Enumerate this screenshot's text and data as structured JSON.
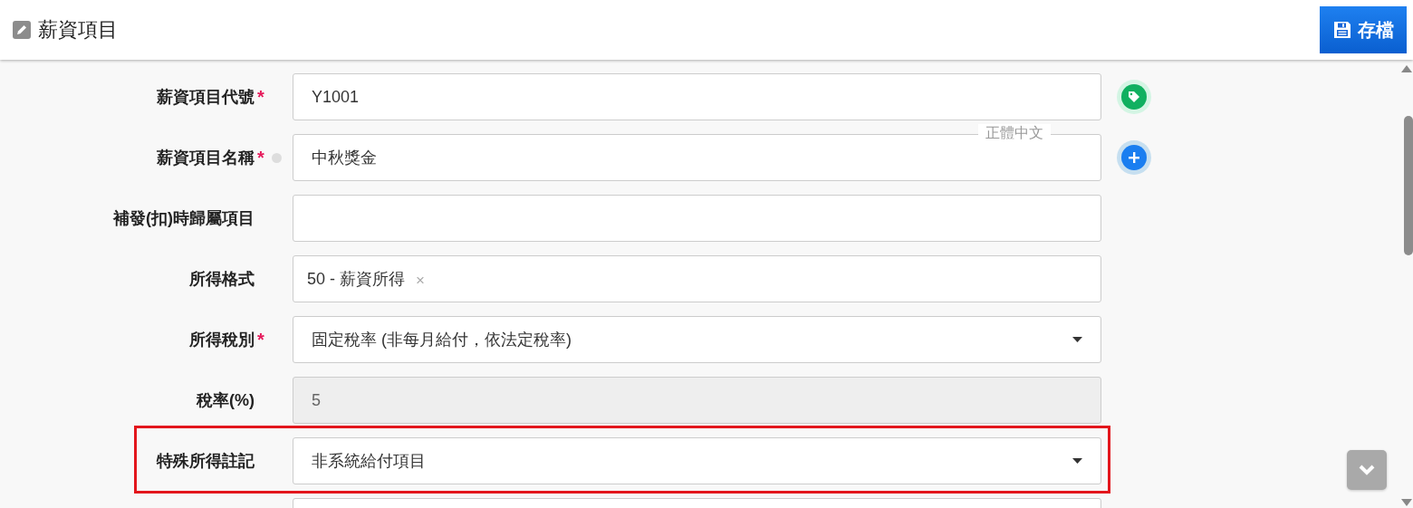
{
  "header": {
    "title": "薪資項目",
    "save_button": "存檔"
  },
  "required_mark": "*",
  "fields": [
    {
      "kind": "text",
      "label": "薪資項目代號",
      "required": true,
      "value": "Y1001",
      "side": {
        "kind": "tag"
      }
    },
    {
      "kind": "text",
      "label": "薪資項目名稱",
      "required": true,
      "translatable": true,
      "value": "中秋獎金",
      "language": "正體中文",
      "side": {
        "kind": "add"
      }
    },
    {
      "kind": "text",
      "label": "補發(扣)時歸屬項目",
      "required": false
    },
    {
      "kind": "tags",
      "label": "所得格式",
      "required": false,
      "tags": [
        {
          "text": "50 - 薪資所得",
          "remove": "×"
        }
      ]
    },
    {
      "kind": "select",
      "label": "所得稅別",
      "required": true,
      "value": "固定稅率 (非每月給付，依法定稅率)"
    },
    {
      "kind": "text",
      "label": "稅率(%)",
      "required": false,
      "disabled": true,
      "value": "5"
    },
    {
      "kind": "select",
      "label": "特殊所得註記",
      "required": false,
      "value": "非系統給付項目",
      "highlighted": true
    },
    {
      "kind": "text",
      "required": false
    }
  ]
}
